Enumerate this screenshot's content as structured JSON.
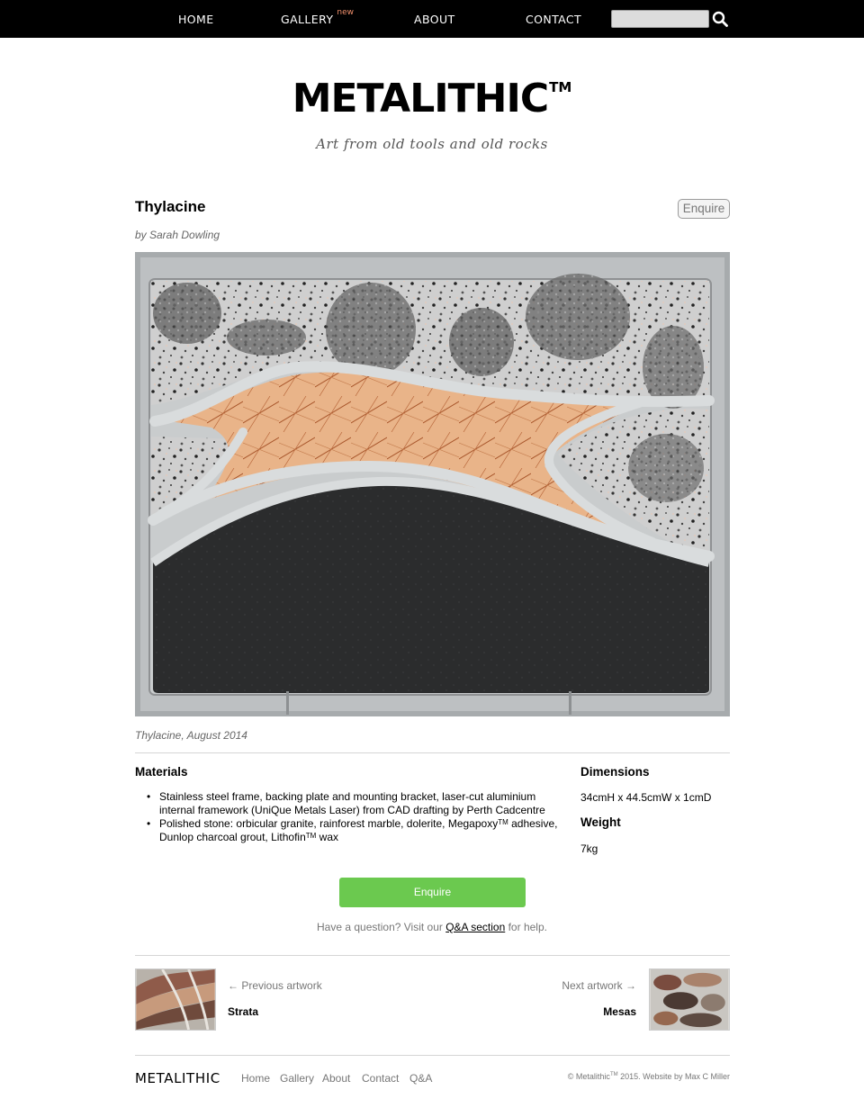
{
  "nav": {
    "home": "HOME",
    "gallery": "GALLERY",
    "gallery_badge": "new",
    "about": "ABOUT",
    "contact": "CONTACT",
    "search_placeholder": ""
  },
  "header": {
    "logo": "METALITHIC",
    "logo_tm": "TM",
    "tagline": "Art from old tools and old rocks"
  },
  "artwork": {
    "title": "Thylacine",
    "enquire_label": "Enquire",
    "artist": "by Sarah Dowling",
    "caption": "Thylacine, August 2014"
  },
  "details": {
    "materials_heading": "Materials",
    "materials_item1": "Stainless steel frame, backing plate and mounting bracket, laser-cut aluminium internal framework (UniQue Metals Laser) from CAD drafting by Perth Cadcentre",
    "materials_item2_a": "Polished stone: orbicular granite, rainforest marble, dolerite, Megapoxy",
    "materials_item2_tm": "TM",
    "materials_item2_b": " adhesive, Dunlop charcoal grout, Lithofin",
    "materials_item2_tm2": "TM",
    "materials_item2_c": " wax",
    "dimensions_heading": "Dimensions",
    "dimensions_value": "34cmH x 44.5cmW x 1cmD",
    "weight_heading": "Weight",
    "weight_value": "7kg"
  },
  "cta": {
    "enquire_label": "Enquire",
    "question_prefix": "Have a question? Visit our ",
    "question_link": "Q&A section",
    "question_suffix": " for help."
  },
  "pager": {
    "prev_label": "← Previous artwork",
    "prev_title": "Strata",
    "next_label": "Next artwork →",
    "next_title": "Mesas"
  },
  "footer": {
    "logo": "METALITHIC",
    "links": [
      "Home",
      "Gallery",
      "About",
      "Contact",
      "Q&A"
    ],
    "copy_a": "© Metalithic",
    "copy_tm": "TM",
    "copy_b": " 2015. Website by Max C Miller"
  },
  "colors": {
    "nav_bg": "#000000",
    "accent_new": "#f08f6c",
    "enquire_green": "#6bc94f"
  }
}
